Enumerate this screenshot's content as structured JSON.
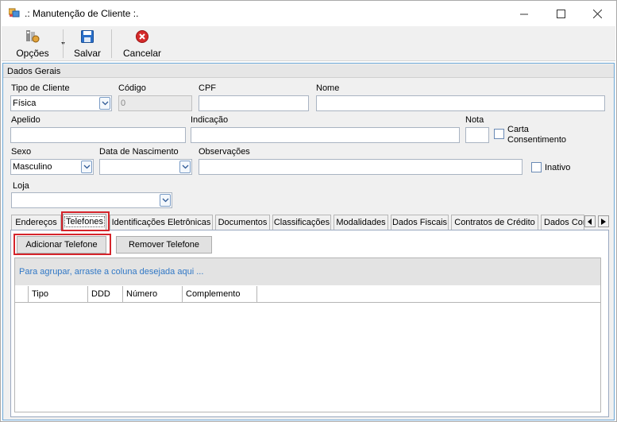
{
  "window": {
    "title": ".: Manutenção de Cliente :.",
    "controls": [
      "minimize",
      "maximize",
      "close"
    ]
  },
  "toolbar": {
    "opcoes_label": "Opções",
    "salvar_label": "Salvar",
    "cancelar_label": "Cancelar"
  },
  "group": {
    "title": "Dados Gerais"
  },
  "form": {
    "tipo_cliente": {
      "label": "Tipo de Cliente",
      "value": "Física"
    },
    "codigo": {
      "label": "Código",
      "value": "0"
    },
    "cpf": {
      "label": "CPF",
      "value": ""
    },
    "nome": {
      "label": "Nome",
      "value": ""
    },
    "apelido": {
      "label": "Apelido",
      "value": ""
    },
    "indicacao": {
      "label": "Indicação",
      "value": ""
    },
    "nota": {
      "label": "Nota",
      "value": ""
    },
    "carta": {
      "label_line1": "Carta",
      "label_line2": "Consentimento"
    },
    "sexo": {
      "label": "Sexo",
      "value": "Masculino"
    },
    "data_nascimento": {
      "label": "Data de Nascimento",
      "value": ""
    },
    "observacoes": {
      "label": "Observações",
      "value": ""
    },
    "inativo": {
      "label": "Inativo"
    },
    "loja": {
      "label": "Loja",
      "value": ""
    }
  },
  "tabs": [
    {
      "label": "Endereços"
    },
    {
      "label": "Telefones"
    },
    {
      "label": "Identificações Eletrônicas"
    },
    {
      "label": "Documentos"
    },
    {
      "label": "Classificações"
    },
    {
      "label": "Modalidades"
    },
    {
      "label": "Dados Fiscais"
    },
    {
      "label": "Contratos de Crédito"
    },
    {
      "label": "Dados Cor"
    }
  ],
  "telefones": {
    "add_button": "Adicionar Telefone",
    "remove_button": "Remover Telefone",
    "group_hint": "Para agrupar, arraste a coluna desejada aqui ...",
    "columns": [
      "Tipo",
      "DDD",
      "Número",
      "Complemento"
    ]
  },
  "colors": {
    "highlight": "#d5242b",
    "frame_blue": "#6aa6d6",
    "hint_blue": "#3178c6"
  }
}
